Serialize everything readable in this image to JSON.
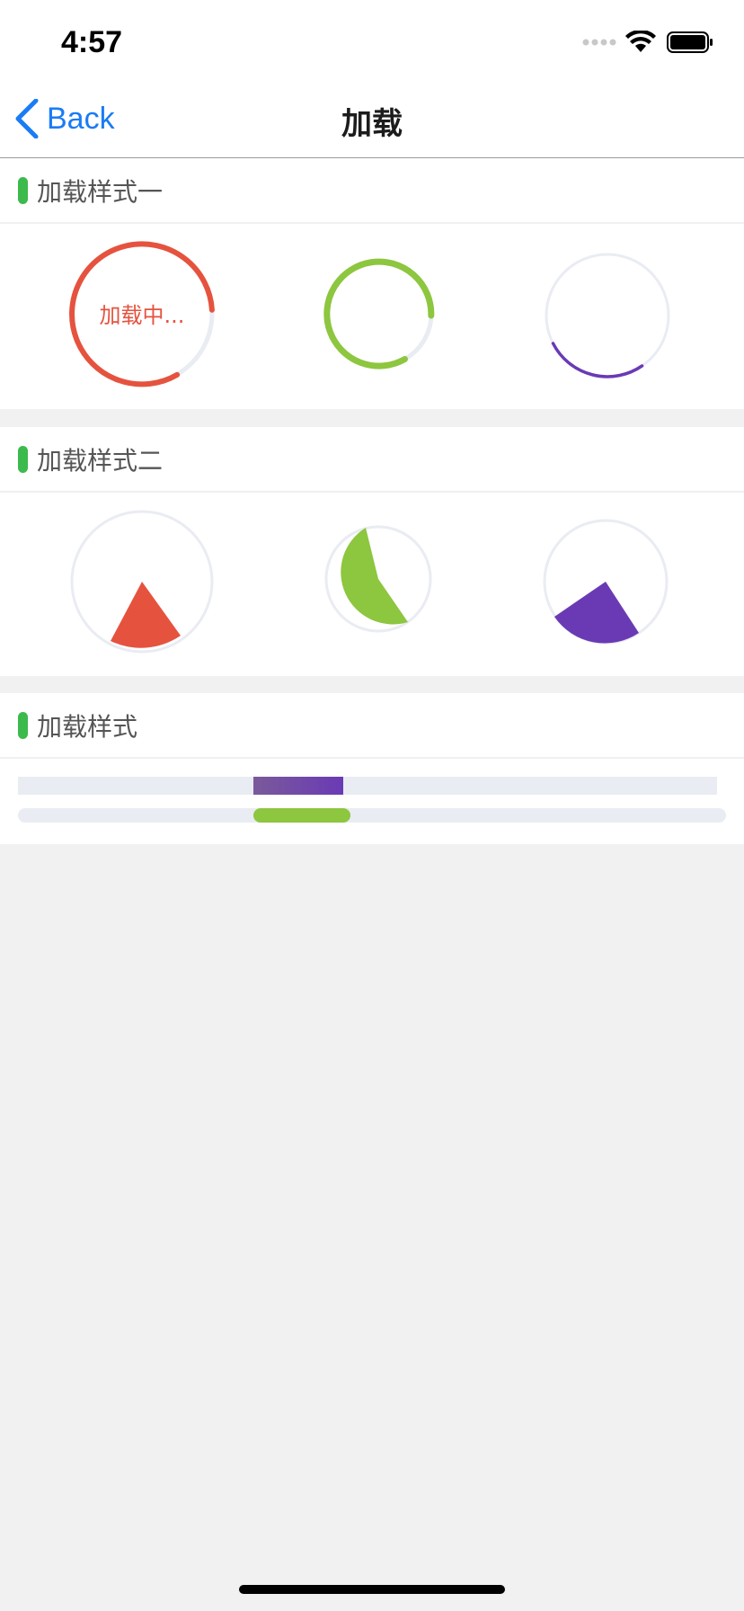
{
  "status_bar": {
    "time": "4:57",
    "icons": [
      "signal-dots-icon",
      "wifi-icon",
      "battery-icon"
    ]
  },
  "nav": {
    "back_label": "Back",
    "title": "加载"
  },
  "sections": [
    {
      "title": "加载样式一",
      "loaders": [
        {
          "type": "ring",
          "color": "#e5533f",
          "progress": 0.75,
          "label": "加载中..."
        },
        {
          "type": "ring",
          "color": "#8dc63f",
          "progress": 0.7
        },
        {
          "type": "ring",
          "color": "#6a3ab5",
          "progress": 0.25
        }
      ]
    },
    {
      "title": "加载样式二",
      "loaders": [
        {
          "type": "wedge",
          "color": "#e5533f"
        },
        {
          "type": "wedge",
          "color": "#8dc63f"
        },
        {
          "type": "wedge",
          "color": "#6a3ab5"
        }
      ]
    },
    {
      "title": "加载样式",
      "bars": [
        {
          "type": "indeterminate-bar",
          "color_start": "#7a5a9a",
          "color_end": "#6a3ab5"
        },
        {
          "type": "indeterminate-bar",
          "color": "#8dc63f"
        }
      ]
    }
  ],
  "colors": {
    "accent": "#3cba4c",
    "link": "#1a7cf5",
    "track": "#e9ecf2",
    "background": "#f1f1f1"
  }
}
